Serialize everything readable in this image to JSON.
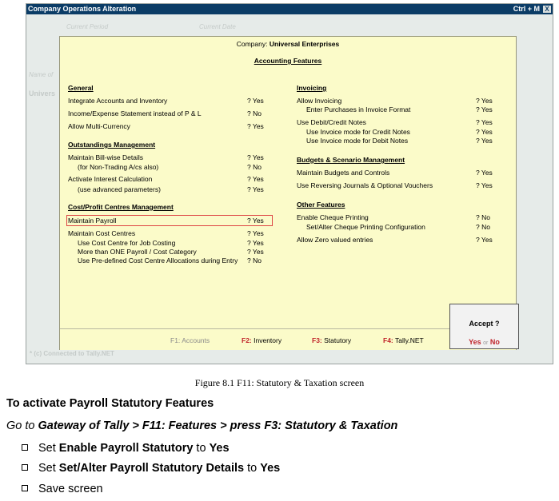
{
  "window": {
    "title": "Company Operations  Alteration",
    "shortcut": "Ctrl + M",
    "close": "X",
    "ghost_current_period": "Current Period",
    "ghost_current_date": "Current Date",
    "ghost_name_of": "Name of",
    "ghost_company": "Univers",
    "connected": "* (c) Connected to Tally.NET"
  },
  "panel": {
    "company_label": "Company:",
    "company_name": "Universal Enterprises",
    "title": "Accounting Features",
    "left": {
      "general": {
        "heading": "General",
        "rows": [
          {
            "label": "Integrate Accounts and Inventory",
            "value": "? Yes"
          },
          {
            "label": "Income/Expense Statement instead of P & L",
            "value": "? No"
          },
          {
            "label": "Allow Multi-Currency",
            "value": "? Yes"
          }
        ]
      },
      "outstandings": {
        "heading": "Outstandings Management",
        "rows": [
          {
            "label": "Maintain Bill-wise Details",
            "value": "? Yes"
          },
          {
            "label": "(for Non-Trading A/cs also)",
            "value": "? No"
          },
          {
            "label": "Activate Interest Calculation",
            "value": "? Yes"
          },
          {
            "label": "(use advanced parameters)",
            "value": "? Yes"
          }
        ]
      },
      "cost_centres": {
        "heading": "Cost/Profit Centres Management",
        "rows": [
          {
            "label": "Maintain Payroll",
            "value": "? Yes"
          },
          {
            "label": "Maintain Cost Centres",
            "value": "? Yes"
          },
          {
            "label": "Use Cost Centre for Job Costing",
            "value": "? Yes"
          },
          {
            "label": "More than ONE Payroll / Cost Category",
            "value": "? Yes"
          },
          {
            "label": "Use Pre-defined Cost Centre Allocations during Entry",
            "value": "? No"
          }
        ]
      }
    },
    "right": {
      "invoicing": {
        "heading": "Invoicing",
        "rows": [
          {
            "label": "Allow Invoicing",
            "value": "? Yes"
          },
          {
            "label": "Enter Purchases in Invoice Format",
            "value": "? Yes"
          },
          {
            "label": "Use Debit/Credit Notes",
            "value": "? Yes"
          },
          {
            "label": "Use Invoice mode for Credit Notes",
            "value": "? Yes"
          },
          {
            "label": "Use Invoice mode for Debit Notes",
            "value": "? Yes"
          }
        ]
      },
      "budgets": {
        "heading": "Budgets & Scenario Management",
        "rows": [
          {
            "label": "Maintain Budgets and Controls",
            "value": "? Yes"
          },
          {
            "label": "Use Reversing Journals & Optional Vouchers",
            "value": "? Yes"
          }
        ]
      },
      "other": {
        "heading": "Other Features",
        "rows": [
          {
            "label": "Enable Cheque Printing",
            "value": "? No"
          },
          {
            "label": "Set/Alter Cheque Printing Configuration",
            "value": "? No"
          },
          {
            "label": "Allow Zero valued entries",
            "value": "? Yes"
          }
        ]
      }
    },
    "fkeys": [
      {
        "key": "F1:",
        "label": "Accounts"
      },
      {
        "key": "F2:",
        "label": "Inventory"
      },
      {
        "key": "F3:",
        "label": "Statutory"
      },
      {
        "key": "F4:",
        "label": "Tally.NET"
      }
    ],
    "accept": {
      "question": "Accept ?",
      "yes": "Yes",
      "or": "or",
      "no": "No"
    }
  },
  "document": {
    "caption": "Figure 8.1  F11: Statutory & Taxation screen",
    "heading": "To activate Payroll Statutory Features",
    "goto_prefix": "Go to ",
    "goto_path": "Gateway of Tally > F11: Features > press F3: Statutory & Taxation",
    "bullets": [
      {
        "pre": "Set ",
        "bold": "Enable Payroll Statutory",
        "mid": " to ",
        "val": "Yes"
      },
      {
        "pre": "Set ",
        "bold": "Set/Alter Payroll Statutory Details",
        "mid": " to ",
        "val": "Yes"
      },
      {
        "pre": "Save screen",
        "bold": "",
        "mid": "",
        "val": ""
      }
    ]
  },
  "colors": {
    "title_bar": "#0b3c66",
    "panel_bg": "#fbfbc9",
    "accent_red": "#c0242b",
    "window_bg": "#e6ebe9"
  }
}
